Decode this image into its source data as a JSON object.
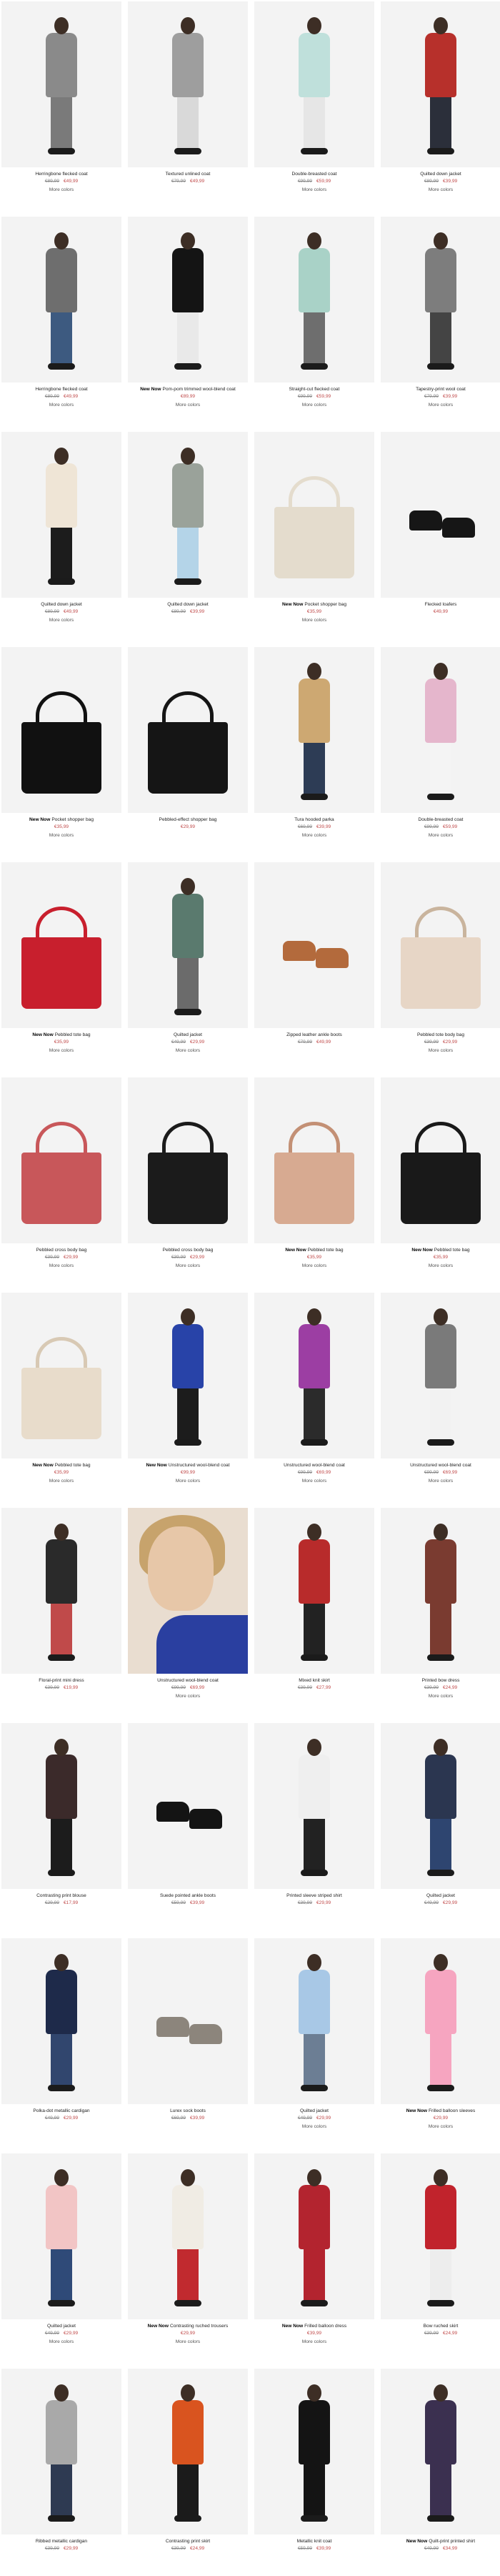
{
  "products": [
    {
      "name": "Herringbone flecked coat",
      "old": "€89,99",
      "price": "€49,99",
      "new": false,
      "more": "More colors",
      "img": {
        "kind": "model",
        "top": "#8a8a8a",
        "bottom": "#7a7a7a",
        "bg": "#f3f3f3"
      }
    },
    {
      "name": "Textured unlined coat",
      "old": "€79,99",
      "price": "€49,99",
      "new": false,
      "more": "",
      "img": {
        "kind": "model",
        "top": "#9e9e9e",
        "bottom": "#d9d9d9",
        "bg": "#f3f3f3"
      }
    },
    {
      "name": "Double-breasted coat",
      "old": "€99,99",
      "price": "€59,99",
      "new": false,
      "more": "More colors",
      "img": {
        "kind": "model",
        "top": "#bfe0db",
        "bottom": "#e6e6e6",
        "bg": "#f3f3f3"
      }
    },
    {
      "name": "Quilted down jacket",
      "old": "€89,99",
      "price": "€39,99",
      "new": false,
      "more": "More colors",
      "img": {
        "kind": "model",
        "top": "#b7302b",
        "bottom": "#2b2f3a",
        "bg": "#f3f3f3"
      }
    },
    {
      "name": "Herringbone flecked coat",
      "old": "€89,99",
      "price": "€49,99",
      "new": false,
      "more": "More colors",
      "img": {
        "kind": "model",
        "top": "#6e6e6e",
        "bottom": "#3d5a80",
        "bg": "#f3f3f3"
      }
    },
    {
      "name": "Pom-pom trimmed wool-blend coat",
      "old": "",
      "price": "€89,99",
      "new": true,
      "more": "More colors",
      "img": {
        "kind": "model",
        "top": "#141414",
        "bottom": "#e9e9e9",
        "bg": "#f3f3f3"
      }
    },
    {
      "name": "Straight-cut flecked coat",
      "old": "€99,99",
      "price": "€59,99",
      "new": false,
      "more": "More colors",
      "img": {
        "kind": "model",
        "top": "#a9d2c7",
        "bottom": "#6e6e6e",
        "bg": "#f3f3f3"
      }
    },
    {
      "name": "Tapestry-print wool coat",
      "old": "€79,99",
      "price": "€39,99",
      "new": false,
      "more": "More colors",
      "img": {
        "kind": "model",
        "top": "#7d7d7d",
        "bottom": "#444444",
        "bg": "#f3f3f3"
      }
    },
    {
      "name": "Quilted down jacket",
      "old": "€89,99",
      "price": "€49,99",
      "new": false,
      "more": "More colors",
      "img": {
        "kind": "model",
        "top": "#efe5d6",
        "bottom": "#1c1c1c",
        "bg": "#f3f3f3"
      }
    },
    {
      "name": "Quilted down jacket",
      "old": "€89,99",
      "price": "€39,99",
      "new": false,
      "more": "",
      "img": {
        "kind": "model",
        "top": "#9aa29a",
        "bottom": "#b4d4e8",
        "bg": "#f3f3f3"
      }
    },
    {
      "name": "Pocket shopper bag",
      "old": "",
      "price": "€35,99",
      "new": true,
      "more": "More colors",
      "img": {
        "kind": "bag",
        "color": "#e4dccd",
        "handle": "#e4dccd",
        "bg": "#f3f3f3"
      }
    },
    {
      "name": "Flecked loafers",
      "old": "",
      "price": "€49,99",
      "new": false,
      "more": "",
      "img": {
        "kind": "shoes",
        "color": "#161616",
        "bg": "#f3f3f3"
      }
    },
    {
      "name": "Pocket shopper bag",
      "old": "",
      "price": "€35,99",
      "new": true,
      "more": "More colors",
      "img": {
        "kind": "bag",
        "color": "#111111",
        "handle": "#111111",
        "bg": "#f3f3f3"
      }
    },
    {
      "name": "Pebbled-effect shopper bag",
      "old": "",
      "price": "€29,99",
      "new": false,
      "more": "",
      "img": {
        "kind": "bag",
        "color": "#151515",
        "handle": "#151515",
        "bg": "#f3f3f3"
      }
    },
    {
      "name": "Tura hooded parka",
      "old": "€69,99",
      "price": "€39,99",
      "new": false,
      "more": "More colors",
      "img": {
        "kind": "model",
        "top": "#cda872",
        "bottom": "#2d3c55",
        "bg": "#f3f3f3"
      }
    },
    {
      "name": "Double-breasted coat",
      "old": "€99,99",
      "price": "€59,99",
      "new": false,
      "more": "More colors",
      "img": {
        "kind": "model",
        "top": "#e5b6cc",
        "bottom": "#f4f4f4",
        "bg": "#f3f3f3"
      }
    },
    {
      "name": "Pebbled tote bag",
      "old": "",
      "price": "€35,99",
      "new": true,
      "more": "More colors",
      "img": {
        "kind": "bag",
        "color": "#c81f2d",
        "handle": "#c81f2d",
        "bg": "#f3f3f3"
      }
    },
    {
      "name": "Quilted jacket",
      "old": "€49,99",
      "price": "€29,99",
      "new": false,
      "more": "More colors",
      "img": {
        "kind": "model",
        "top": "#5a7a6e",
        "bottom": "#6b6b6b",
        "bg": "#f3f3f3"
      }
    },
    {
      "name": "Zipped leather ankle boots",
      "old": "€79,99",
      "price": "€49,99",
      "new": false,
      "more": "",
      "img": {
        "kind": "shoes",
        "color": "#b36a3c",
        "bg": "#f3f3f3"
      }
    },
    {
      "name": "Pebbled tote body bag",
      "old": "€39,99",
      "price": "€29,99",
      "new": false,
      "more": "More colors",
      "img": {
        "kind": "bag",
        "color": "#e7d6c6",
        "handle": "#c9b49d",
        "bg": "#f3f3f3"
      }
    },
    {
      "name": "Pebbled cross body bag",
      "old": "€39,99",
      "price": "€29,99",
      "new": false,
      "more": "More colors",
      "img": {
        "kind": "bag",
        "color": "#c8575a",
        "handle": "#c8575a",
        "bg": "#f3f3f3"
      }
    },
    {
      "name": "Pebbled cross body bag",
      "old": "€39,99",
      "price": "€29,99",
      "new": false,
      "more": "More colors",
      "img": {
        "kind": "bag",
        "color": "#1b1b1b",
        "handle": "#1b1b1b",
        "bg": "#f3f3f3"
      }
    },
    {
      "name": "Pebbled tote bag",
      "old": "",
      "price": "€35,99",
      "new": true,
      "more": "More colors",
      "img": {
        "kind": "bag",
        "color": "#d7aa91",
        "handle": "#c39075",
        "bg": "#f3f3f3"
      }
    },
    {
      "name": "Pebbled tote bag",
      "old": "",
      "price": "€35,99",
      "new": true,
      "more": "More colors",
      "img": {
        "kind": "bag",
        "color": "#191919",
        "handle": "#191919",
        "bg": "#f3f3f3"
      }
    },
    {
      "name": "Pebbled tote bag",
      "old": "",
      "price": "€35,99",
      "new": true,
      "more": "More colors",
      "img": {
        "kind": "bag",
        "color": "#e8dccb",
        "handle": "#d8c9b4",
        "bg": "#f3f3f3"
      }
    },
    {
      "name": "Unstructured wool-blend coat",
      "old": "",
      "price": "€99,99",
      "new": true,
      "more": "More colors",
      "img": {
        "kind": "model",
        "top": "#2843a8",
        "bottom": "#1c1c1c",
        "bg": "#f3f3f3"
      }
    },
    {
      "name": "Unstructured wool-blend coat",
      "old": "€99,99",
      "price": "€69,99",
      "new": false,
      "more": "More colors",
      "img": {
        "kind": "model",
        "top": "#9c3ea3",
        "bottom": "#2b2b2b",
        "bg": "#f3f3f3"
      }
    },
    {
      "name": "Unstructured wool-blend coat",
      "old": "€99,99",
      "price": "€69,99",
      "new": false,
      "more": "More colors",
      "img": {
        "kind": "model",
        "top": "#7a7a7a",
        "bottom": "#f2f2f2",
        "bg": "#f3f3f3"
      }
    },
    {
      "name": "Floral-print mini dress",
      "old": "€39,99",
      "price": "€19,99",
      "new": false,
      "more": "",
      "img": {
        "kind": "model",
        "top": "#2a2a2a",
        "bottom": "#c04a4a",
        "bg": "#f3f3f3"
      }
    },
    {
      "name": "Unstructured wool-blend coat",
      "old": "€99,99",
      "price": "€69,99",
      "new": false,
      "more": "More colors",
      "img": {
        "kind": "portrait",
        "top": "#2a3fa0",
        "bg": "#e9ddd0"
      }
    },
    {
      "name": "Mixed knit skirt",
      "old": "€39,99",
      "price": "€27,99",
      "new": false,
      "more": "",
      "img": {
        "kind": "model",
        "top": "#b82b2b",
        "bottom": "#222222",
        "bg": "#f3f3f3"
      }
    },
    {
      "name": "Printed bow dress",
      "old": "€39,99",
      "price": "€24,99",
      "new": false,
      "more": "More colors",
      "img": {
        "kind": "model",
        "top": "#7a3b30",
        "bottom": "#7a3b30",
        "bg": "#f3f3f3"
      }
    },
    {
      "name": "Contrasting print blouse",
      "old": "€29,99",
      "price": "€17,99",
      "new": false,
      "more": "",
      "img": {
        "kind": "model",
        "top": "#3b2a2a",
        "bottom": "#1c1c1c",
        "bg": "#f3f3f3"
      }
    },
    {
      "name": "Suede pointed ankle boots",
      "old": "€59,99",
      "price": "€39,99",
      "new": false,
      "more": "",
      "img": {
        "kind": "shoes",
        "color": "#141414",
        "bg": "#f3f3f3"
      }
    },
    {
      "name": "Printed sleeve striped shirt",
      "old": "€39,99",
      "price": "€29,99",
      "new": false,
      "more": "",
      "img": {
        "kind": "model",
        "top": "#efefef",
        "bottom": "#222222",
        "bg": "#f3f3f3"
      }
    },
    {
      "name": "Quilted jacket",
      "old": "€49,99",
      "price": "€29,99",
      "new": false,
      "more": "",
      "img": {
        "kind": "model",
        "top": "#2b3650",
        "bottom": "#2e4570",
        "bg": "#f3f3f3"
      }
    },
    {
      "name": "Polka-dot metallic cardigan",
      "old": "€49,99",
      "price": "€29,99",
      "new": false,
      "more": "",
      "img": {
        "kind": "model",
        "top": "#1e2a4a",
        "bottom": "#31466e",
        "bg": "#f3f3f3"
      }
    },
    {
      "name": "Lurex sock boots",
      "old": "€69,99",
      "price": "€39,99",
      "new": false,
      "more": "",
      "img": {
        "kind": "shoes",
        "color": "#8c857c",
        "bg": "#f3f3f3"
      }
    },
    {
      "name": "Quilted jacket",
      "old": "€49,99",
      "price": "€29,99",
      "new": false,
      "more": "More colors",
      "img": {
        "kind": "model",
        "top": "#a8c8e6",
        "bottom": "#6c7e94",
        "bg": "#f3f3f3"
      }
    },
    {
      "name": "Frilled balloon sleeves",
      "old": "",
      "price": "€29,99",
      "new": true,
      "more": "More colors",
      "img": {
        "kind": "model",
        "top": "#f6a5c0",
        "bottom": "#f6a5c0",
        "bg": "#f3f3f3"
      }
    },
    {
      "name": "Quilted jacket",
      "old": "€49,99",
      "price": "€29,99",
      "new": false,
      "more": "More colors",
      "img": {
        "kind": "model",
        "top": "#f2c5c5",
        "bottom": "#2f4a78",
        "bg": "#f3f3f3"
      }
    },
    {
      "name": "Contrasting ruched trousers",
      "old": "",
      "price": "€29,99",
      "new": true,
      "more": "More colors",
      "img": {
        "kind": "model",
        "top": "#f0ece4",
        "bottom": "#c12a2f",
        "bg": "#f3f3f3"
      }
    },
    {
      "name": "Frilled balloon dress",
      "old": "",
      "price": "€39,99",
      "new": true,
      "more": "More colors",
      "img": {
        "kind": "model",
        "top": "#b3242f",
        "bottom": "#b3242f",
        "bg": "#f3f3f3"
      }
    },
    {
      "name": "Bow ruched skirt",
      "old": "€39,99",
      "price": "€24,99",
      "new": false,
      "more": "",
      "img": {
        "kind": "model",
        "top": "#c1232c",
        "bottom": "#ededed",
        "bg": "#f3f3f3"
      }
    },
    {
      "name": "Ribbed metallic cardigan",
      "old": "€39,99",
      "price": "€29,99",
      "new": false,
      "more": "",
      "img": {
        "kind": "model",
        "top": "#a9a9a9",
        "bottom": "#2e3a52",
        "bg": "#f3f3f3"
      }
    },
    {
      "name": "Contrasting print skirt",
      "old": "€39,99",
      "price": "€24,99",
      "new": false,
      "more": "",
      "img": {
        "kind": "model",
        "top": "#d9541f",
        "bottom": "#1b1b1b",
        "bg": "#f3f3f3"
      }
    },
    {
      "name": "Metallic knit coat",
      "old": "€59,99",
      "price": "€39,99",
      "new": false,
      "more": "",
      "img": {
        "kind": "model",
        "top": "#141414",
        "bottom": "#141414",
        "bg": "#f3f3f3"
      }
    },
    {
      "name": "Quilt-print printed shirt",
      "old": "€49,99",
      "price": "€34,99",
      "new": true,
      "more": "",
      "img": {
        "kind": "model",
        "top": "#3b3050",
        "bottom": "#3b3050",
        "bg": "#f3f3f3"
      }
    }
  ],
  "labels": {
    "new_badge": "New Now"
  }
}
